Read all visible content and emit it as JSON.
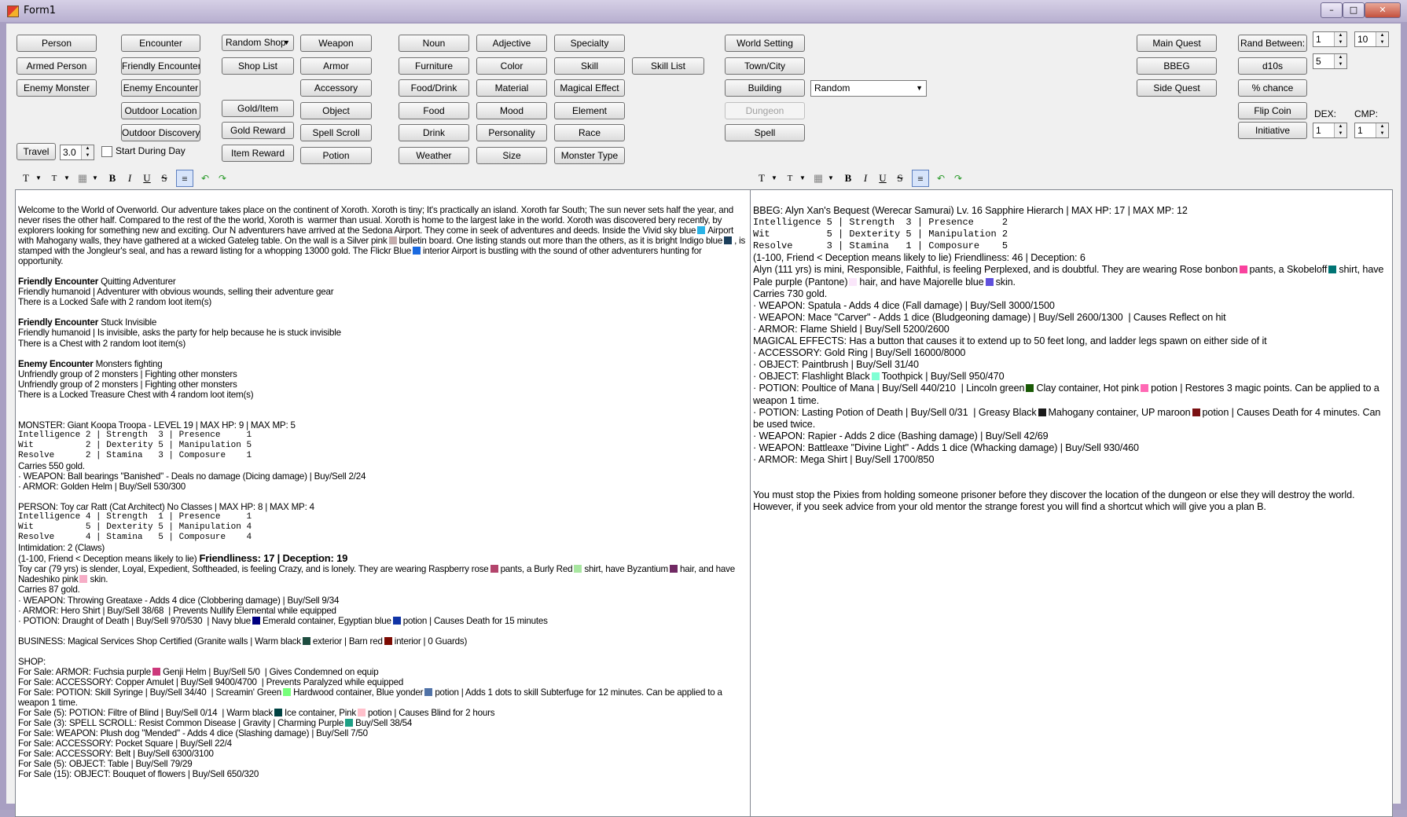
{
  "window": {
    "title": "Form1"
  },
  "buttons": {
    "person": "Person",
    "armed_person": "Armed Person",
    "enemy_monster": "Enemy Monster",
    "travel": "Travel",
    "encounter": "Encounter",
    "friendly_encounter": "Friendly Encounter",
    "enemy_encounter": "Enemy Encounter",
    "outdoor_location": "Outdoor Location",
    "outdoor_discovery": "Outdoor Discovery",
    "shop_list": "Shop List",
    "gold_item": "Gold/Item",
    "gold_reward": "Gold Reward",
    "item_reward": "Item Reward",
    "weapon": "Weapon",
    "armor": "Armor",
    "accessory": "Accessory",
    "object": "Object",
    "spell_scroll": "Spell Scroll",
    "potion": "Potion",
    "noun": "Noun",
    "furniture": "Furniture",
    "food_drink": "Food/Drink",
    "food": "Food",
    "drink": "Drink",
    "weather": "Weather",
    "adjective": "Adjective",
    "color": "Color",
    "material": "Material",
    "mood": "Mood",
    "personality": "Personality",
    "size": "Size",
    "specialty": "Specialty",
    "skill": "Skill",
    "magical_effect": "Magical Effect",
    "element": "Element",
    "race": "Race",
    "monster_type": "Monster Type",
    "skill_list": "Skill List",
    "world_setting": "World Setting",
    "town_city": "Town/City",
    "building": "Building",
    "dungeon": "Dungeon",
    "spell": "Spell",
    "main_quest": "Main Quest",
    "bbeg": "BBEG",
    "side_quest": "Side Quest",
    "rand_between": "Rand Between:",
    "d10s": "d10s",
    "pct_chance": "% chance",
    "flip_coin": "Flip Coin",
    "initiative": "Initiative"
  },
  "controls": {
    "shop_combo": "Random Shop",
    "building_combo": "Random",
    "travel_value": "3.0",
    "start_during_day": "Start During Day",
    "rand_min": "1",
    "rand_max": "10",
    "d10_count": "5",
    "dex_label": "DEX:",
    "cmp_label": "CMP:",
    "dex_value": "1",
    "cmp_value": "1"
  },
  "toolbar": {
    "font": "T",
    "size": "T",
    "bold": "B",
    "italic": "I",
    "underline": "U",
    "strike": "S",
    "align": "≡",
    "undo": "↶",
    "redo": "↷"
  },
  "colors": {
    "sky_blue": "#2ab3e6",
    "mahogany_dark": "#1b3f5c",
    "silver_pink": "#c4aead",
    "indigo_blue": "#1b6ae0",
    "raspberry_rose": "#b3446c",
    "burly_red": "#a8e6a0",
    "byzantium": "#702963",
    "nadeshiko_pink": "#f6adc6",
    "navy_blue": "#000080",
    "emerald_green": "#1f6f4a",
    "egyptian_blue": "#1034a6",
    "granite": "#1e4d40",
    "barn_red": "#7c0a02",
    "fuchsia_purple": "#cc397b",
    "screamin_green": "#76ff7a",
    "blue_yonder": "#5072a7",
    "warm_black": "#004242",
    "pink": "#ffc0cb",
    "charming_purple": "#1ea086",
    "rose_bonbon": "#f9429e",
    "skobeloff": "#007474",
    "pale_purple": "#fae6fa",
    "majorelle_blue": "#6050dc",
    "flashlight_black": "#7fffd4",
    "lincoln_green": "#195905",
    "hot_pink": "#ff69b4",
    "greasy_black": "#1a1a1a",
    "up_maroon": "#7b1113"
  },
  "left_text": {
    "intro": "Welcome to the World of Overworld. Our adventure takes place on the continent of Xoroth. Xoroth is tiny; It's practically an island. Xoroth far South; The sun never sets half the year, and never rises the other half. Compared to the rest of the the world, Xoroth is  warmer than usual. Xoroth is home to the largest lake in the world. Xoroth was discovered bery recently, by explorers looking for something new and exciting. Our N adventurers have arrived at the Sedona Airport. They come in seek of adventures and deeds. Inside the Vivid sky blue",
    "intro_b": "Airport with Mahogany walls, they have gathered at a wicked Gateleg table. On the wall is a Silver pink",
    "intro_c": "bulletin board. One listing stands out more than the others, as it is bright Indigo blue",
    "intro_d": ", is stamped with the Jongleur's seal, and has a reward listing for a whopping 13000 gold. The Flickr Blue",
    "intro_e": "interior Airport is bustling with the sound of other adventurers hunting for opportunity.",
    "fe1_head": "Friendly Encounter",
    "fe1_title": " Quitting Adventurer",
    "fe1_l1": "Friendly humanoid | Adventurer with obvious wounds, selling their adventure gear",
    "fe1_l2": "There is a Locked Safe with 2 random loot item(s)",
    "fe2_head": "Friendly Encounter",
    "fe2_title": " Stuck Invisible",
    "fe2_l1": "Friendly humanoid | Is invisible, asks the party for help because he is stuck invisible",
    "fe2_l2": "There is a Chest with 2 random loot item(s)",
    "ee_head": "Enemy Encounter",
    "ee_title": " Monsters fighting",
    "ee_l1": "Unfriendly group of 2 monsters | Fighting other monsters",
    "ee_l2": "Unfriendly group of 2 monsters | Fighting other monsters",
    "ee_l3": "There is a Locked Treasure Chest with 4 random loot item(s)",
    "mon_head": "MONSTER: Giant Koopa Troopa - LEVEL 19 | MAX HP: 9 | MAX MP: 5",
    "mon_s1": "Intelligence 2 | Strength  3 | Presence     1",
    "mon_s2": "Wit          2 | Dexterity 5 | Manipulation 5",
    "mon_s3": "Resolve      2 | Stamina   3 | Composure    1",
    "mon_gold": "Carries 550 gold.",
    "mon_w": "· WEAPON: Ball bearings \"Banished\" - Deals no damage (Dicing damage) | Buy/Sell 2/24",
    "mon_a": "· ARMOR: Golden Helm | Buy/Sell 530/300",
    "per_head": "PERSON: Toy car Ratt (Cat Architect) No Classes | MAX HP: 8 | MAX MP: 4",
    "per_s1": "Intelligence 4 | Strength  1 | Presence     1",
    "per_s2": "Wit          5 | Dexterity 5 | Manipulation 4",
    "per_s3": "Resolve      4 | Stamina   5 | Composure    4",
    "per_int": "Intimidation: 2 (Claws)",
    "per_fd_a": "(1-100, Friend < Deception means likely to lie) ",
    "per_fd_b": "Friendliness: 17 | Deception: 19",
    "per_desc_a": "Toy car (79 yrs) is slender, Loyal, Expedient, Softheaded, is feeling Crazy, and is lonely. They are wearing Raspberry rose",
    "per_desc_b": "pants, a Burly Red",
    "per_desc_c": "shirt, have Byzantium",
    "per_desc_d": "hair, and have Nadeshiko pink",
    "per_desc_e": "skin.",
    "per_gold": "Carries 87 gold.",
    "per_w": "· WEAPON: Throwing Greataxe - Adds 4 dice (Clobbering damage) | Buy/Sell 9/34",
    "per_a": "· ARMOR: Hero Shirt | Buy/Sell 38/68  | Prevents Nullify Elemental while equipped",
    "per_p_a": "· POTION: Draught of Death | Buy/Sell 970/530  | Navy blue",
    "per_p_b": "Emerald container, Egyptian blue",
    "per_p_c": "potion | Causes Death for 15 minutes",
    "biz_a": "BUSINESS: Magical Services Shop Certified (Granite walls | Warm black",
    "biz_b": "exterior | Barn red",
    "biz_c": "interior | 0 Guards)",
    "shop": "SHOP:",
    "s1_a": "For Sale: ARMOR: Fuchsia purple",
    "s1_b": "Genji Helm | Buy/Sell 5/0  | Gives Condemned on equip",
    "s2": "For Sale: ACCESSORY: Copper Amulet | Buy/Sell 9400/4700  | Prevents Paralyzed while equipped",
    "s3_a": "For Sale: POTION: Skill Syringe | Buy/Sell 34/40  | Screamin' Green",
    "s3_b": "Hardwood container, Blue yonder",
    "s3_c": "potion | Adds 1 dots to skill Subterfuge for 12 minutes. Can be applied to a weapon 1 time.",
    "s4_a": "For Sale (5): POTION: Filtre of Blind | Buy/Sell 0/14  | Warm black",
    "s4_b": "Ice container, Pink",
    "s4_c": "potion | Causes Blind for 2 hours",
    "s5_a": "For Sale (3): SPELL SCROLL: Resist Common Disease | Gravity | Charming Purple",
    "s5_b": "Buy/Sell 38/54",
    "s6": "For Sale: WEAPON: Plush dog \"Mended\" - Adds 4 dice (Slashing damage) | Buy/Sell 7/50",
    "s7": "For Sale: ACCESSORY: Pocket Square | Buy/Sell 22/4",
    "s8": "For Sale: ACCESSORY: Belt | Buy/Sell 6300/3100",
    "s9": "For Sale (5): OBJECT: Table | Buy/Sell 79/29",
    "s10": "For Sale (15): OBJECT: Bouquet of flowers | Buy/Sell 650/320"
  },
  "right_text": {
    "head": "BBEG: Alyn Xan's Bequest (Werecar Samurai) Lv. 16 Sapphire Hierarch | MAX HP: 17 | MAX MP: 12",
    "s1": "Intelligence 5 | Strength  3 | Presence     2",
    "s2": "Wit          5 | Dexterity 5 | Manipulation 2",
    "s3": "Resolve      3 | Stamina   1 | Composure    5",
    "fd": "(1-100, Friend < Deception means likely to lie) Friendliness: 46 | Deception: 6",
    "desc_a": "Alyn (111 yrs) is mini, Responsible, Faithful, is feeling Perplexed, and is doubtful. They are wearing Rose bonbon",
    "desc_b": "pants, a Skobeloff",
    "desc_c": "shirt, have Pale purple (Pantone)",
    "desc_d": "hair, and have Majorelle blue",
    "desc_e": "skin.",
    "gold": "Carries 730 gold.",
    "w1": "· WEAPON: Spatula - Adds 4 dice (Fall damage) | Buy/Sell 3000/1500",
    "w2": "· WEAPON: Mace \"Carver\" - Adds 1 dice (Bludgeoning damage) | Buy/Sell 2600/1300  | Causes Reflect on hit",
    "a1": "· ARMOR: Flame Shield | Buy/Sell 5200/2600",
    "me": "MAGICAL EFFECTS: Has a button that causes it to extend up to 50 feet long, and ladder legs spawn on either side of it",
    "acc": "· ACCESSORY: Gold Ring | Buy/Sell 16000/8000",
    "o1": "· OBJECT: Paintbrush | Buy/Sell 31/40",
    "o2_a": "· OBJECT: Flashlight Black",
    "o2_b": "Toothpick | Buy/Sell 950/470",
    "p1_a": "· POTION: Poultice of Mana | Buy/Sell 440/210  | Lincoln green",
    "p1_b": "Clay container, Hot pink",
    "p1_c": "potion | Restores 3 magic points. Can be applied to a weapon 1 time.",
    "p2_a": "· POTION: Lasting Potion of Death | Buy/Sell 0/31  | Greasy Black",
    "p2_b": "Mahogany container, UP maroon",
    "p2_c": "potion | Causes Death for 4 minutes. Can be used twice.",
    "w3": "· WEAPON: Rapier - Adds 2 dice (Bashing damage) | Buy/Sell 42/69",
    "w4": "· WEAPON: Battleaxe \"Divine Light\" - Adds 1 dice (Whacking damage) | Buy/Sell 930/460",
    "a2": "· ARMOR: Mega Shirt | Buy/Sell 1700/850",
    "quest": "You must stop the Pixies from holding someone prisoner before they discover the location of the dungeon or else they will destroy the world. However, if you seek advice from your old mentor the strange forest you will find a shortcut which will give you a plan B."
  }
}
